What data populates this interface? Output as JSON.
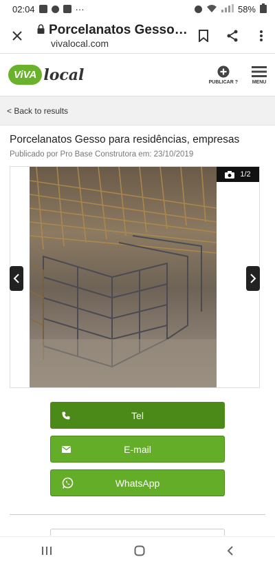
{
  "status": {
    "time": "02:04",
    "dots": "···",
    "battery": "58%"
  },
  "browser": {
    "page_title": "Porcelanatos Gesso…",
    "domain": "vivalocal.com"
  },
  "site": {
    "logo_badge": "ViVA",
    "logo_text": "local",
    "publicar_label": "PUBLICAR ?",
    "menu_label": "MENU"
  },
  "back_link": "< Back to results",
  "listing": {
    "title": "Porcelanatos Gesso para residências, empresas",
    "published": "Publicado por Pro Base Construtora em: 23/10/2019",
    "photo_counter": "1/2"
  },
  "contact": {
    "tel_label": "Tel",
    "email_label": "E-mail",
    "whatsapp_label": "WhatsApp"
  },
  "colors": {
    "brand_green": "#63ad29",
    "dark_green": "#4b8a18"
  },
  "icons": [
    "close-icon",
    "lock-icon",
    "bookmark-icon",
    "share-icon",
    "more-vert-icon",
    "plus-circle-icon",
    "hamburger-icon",
    "camera-icon",
    "chevron-left-icon",
    "chevron-right-icon",
    "phone-icon",
    "envelope-icon",
    "whatsapp-icon",
    "recents-icon",
    "home-icon",
    "back-icon"
  ]
}
